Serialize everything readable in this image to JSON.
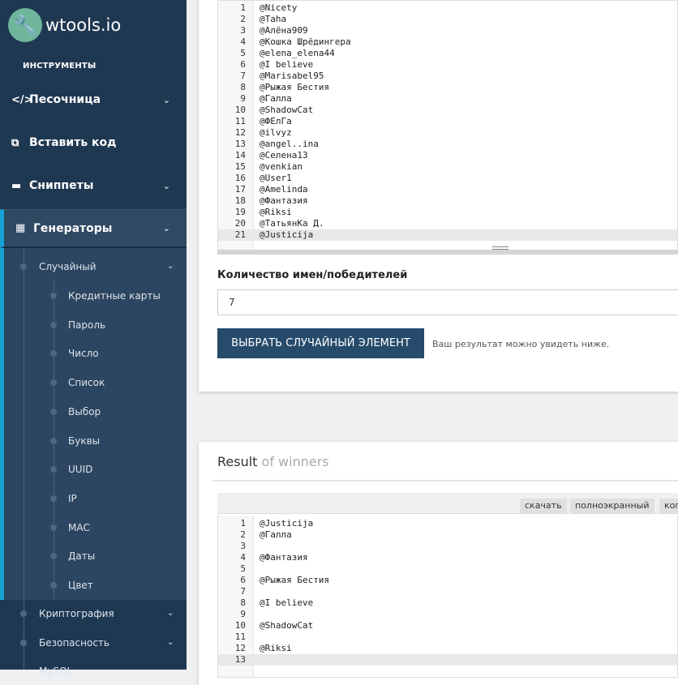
{
  "sidebar": {
    "logo": "wtools.io",
    "section": "ИНСТРУМЕНТЫ",
    "top_items": [
      {
        "label": "Песочница",
        "icon": "code-icon"
      },
      {
        "label": "Вставить код",
        "icon": "paste-icon"
      },
      {
        "label": "Сниппеты",
        "icon": "snippet-icon"
      },
      {
        "label": "Генераторы",
        "icon": "generator-icon"
      }
    ],
    "random_group": "Случайный",
    "random_items": [
      "Кредитные карты",
      "Пароль",
      "Число",
      "Список",
      "Выбор",
      "Буквы",
      "UUID",
      "IP",
      "MAC",
      "Даты",
      "Цвет"
    ],
    "more_groups": [
      "Криптография",
      "Безопасность",
      "MySQL"
    ]
  },
  "input_editor": {
    "lines": [
      "@Nicety",
      "@Taha",
      "@Алёна909",
      "@Кошка Шрёдингера",
      "@elena_elena44",
      "@I believe",
      "@Marisabel95",
      "@Рыжая Бестия",
      "@Галла",
      "@ShadowCat",
      "@ФЕлГа",
      "@ilvyz",
      "@angel..ina",
      "@Селена13",
      "@venkian",
      "@User1",
      "@Amelinda",
      "@Фантазия",
      "@Riksi",
      "@ТатьянКа Д.",
      "@Justicija"
    ]
  },
  "form": {
    "count_label": "Количество имен/победителей",
    "count_value": "7",
    "submit": "ВЫБРАТЬ СЛУЧАЙНЫЙ ЭЛЕМЕНТ",
    "hint": "Ваш результат можно увидеть ниже."
  },
  "result": {
    "title_main": "Result",
    "title_muted": "of winners",
    "buttons": [
      "скачать",
      "полноэкранный",
      "коп"
    ],
    "lines": [
      "@Justicija",
      "@Галла",
      "",
      "@Фантазия",
      "",
      "@Рыжая Бестия",
      "",
      "@I believe",
      "",
      "@ShadowCat",
      "",
      "@Riksi",
      ""
    ]
  }
}
